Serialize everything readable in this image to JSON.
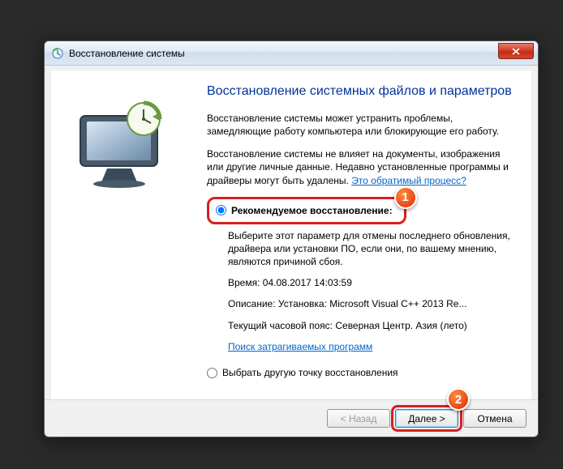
{
  "window": {
    "title": "Восстановление системы"
  },
  "content": {
    "heading": "Восстановление системных файлов и параметров",
    "para1": "Восстановление системы может устранить проблемы, замедляющие работу компьютера или блокирующие его работу.",
    "para2_prefix": "Восстановление системы не влияет на документы, изображения или другие личные данные. Недавно установленные программы и драйверы могут быть удалены. ",
    "para2_link": "Это обратимый процесс?"
  },
  "options": {
    "recommended": {
      "label": "Рекомендуемое восстановление:",
      "description": "Выберите этот параметр для отмены последнего обновления, драйвера или установки ПО, если они, по вашему мнению, являются причиной сбоя.",
      "time_line": "Время: 04.08.2017 14:03:59",
      "desc_line": "Описание: Установка: Microsoft Visual C++ 2013 Re...",
      "tz_line": "Текущий часовой пояс: Северная Центр. Азия (лето)",
      "affected_link": "Поиск затрагиваемых программ"
    },
    "choose_other": {
      "label": "Выбрать другую точку восстановления"
    }
  },
  "buttons": {
    "back": "< Назад",
    "next": "Далее >",
    "cancel": "Отмена"
  },
  "badges": {
    "one": "1",
    "two": "2"
  }
}
